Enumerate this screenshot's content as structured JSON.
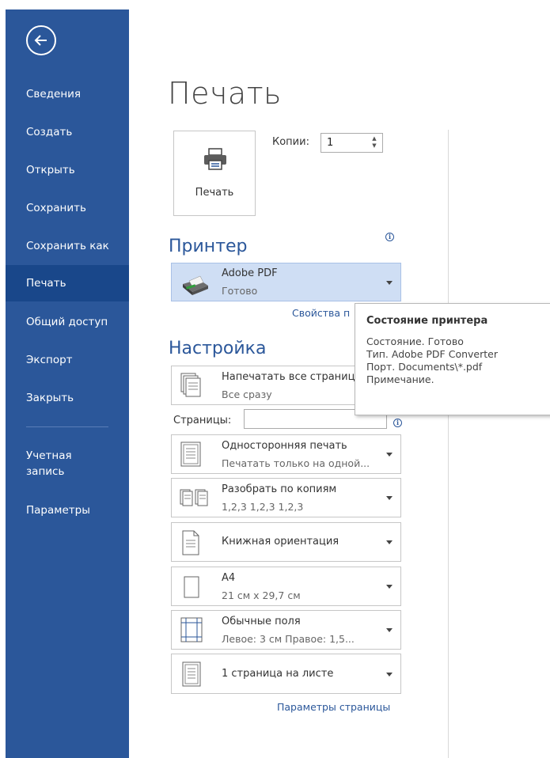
{
  "sidebar": {
    "items": [
      {
        "label": "Сведения"
      },
      {
        "label": "Создать"
      },
      {
        "label": "Открыть"
      },
      {
        "label": "Сохранить"
      },
      {
        "label": "Сохранить как"
      },
      {
        "label": "Печать",
        "active": true
      },
      {
        "label": "Общий доступ"
      },
      {
        "label": "Экспорт"
      },
      {
        "label": "Закрыть"
      }
    ],
    "account_label": "Учетная запись",
    "account_line1": "Учетная",
    "account_line2": "запись",
    "options_label": "Параметры"
  },
  "page_title": "Печать",
  "print_button": {
    "label": "Печать"
  },
  "copies": {
    "label": "Копии:",
    "value": "1"
  },
  "printer_section": {
    "title": "Принтер",
    "selected_name": "Adobe PDF",
    "selected_status": "Готово",
    "properties_link": "Свойства п"
  },
  "settings_section": {
    "title": "Настройка",
    "print_range": {
      "main": "Напечатать все страниц",
      "sub": "Все сразу"
    },
    "pages_label": "Страницы:",
    "pages_value": "",
    "sides": {
      "main": "Односторонняя печать",
      "sub": "Печатать только на одной..."
    },
    "collate": {
      "main": "Разобрать по копиям",
      "sub": "1,2,3    1,2,3    1,2,3"
    },
    "orientation": {
      "main": "Книжная ориентация"
    },
    "paper": {
      "main": "A4",
      "sub": "21 см x 29,7 см"
    },
    "margins": {
      "main": "Обычные поля",
      "sub": "Левое: 3 см   Правое: 1,5..."
    },
    "per_sheet": {
      "main": "1 страница на листе"
    },
    "page_setup_link": "Параметры страницы"
  },
  "tooltip": {
    "title": "Состояние принтера",
    "lines": [
      "Состояние. Готово",
      "Тип. Adobe PDF Converter",
      "Порт. Documents\\*.pdf",
      "Примечание."
    ]
  },
  "colors": {
    "accent": "#2b579a",
    "sidebar_active": "#19478a",
    "printer_selected_bg": "#cfdef4"
  }
}
